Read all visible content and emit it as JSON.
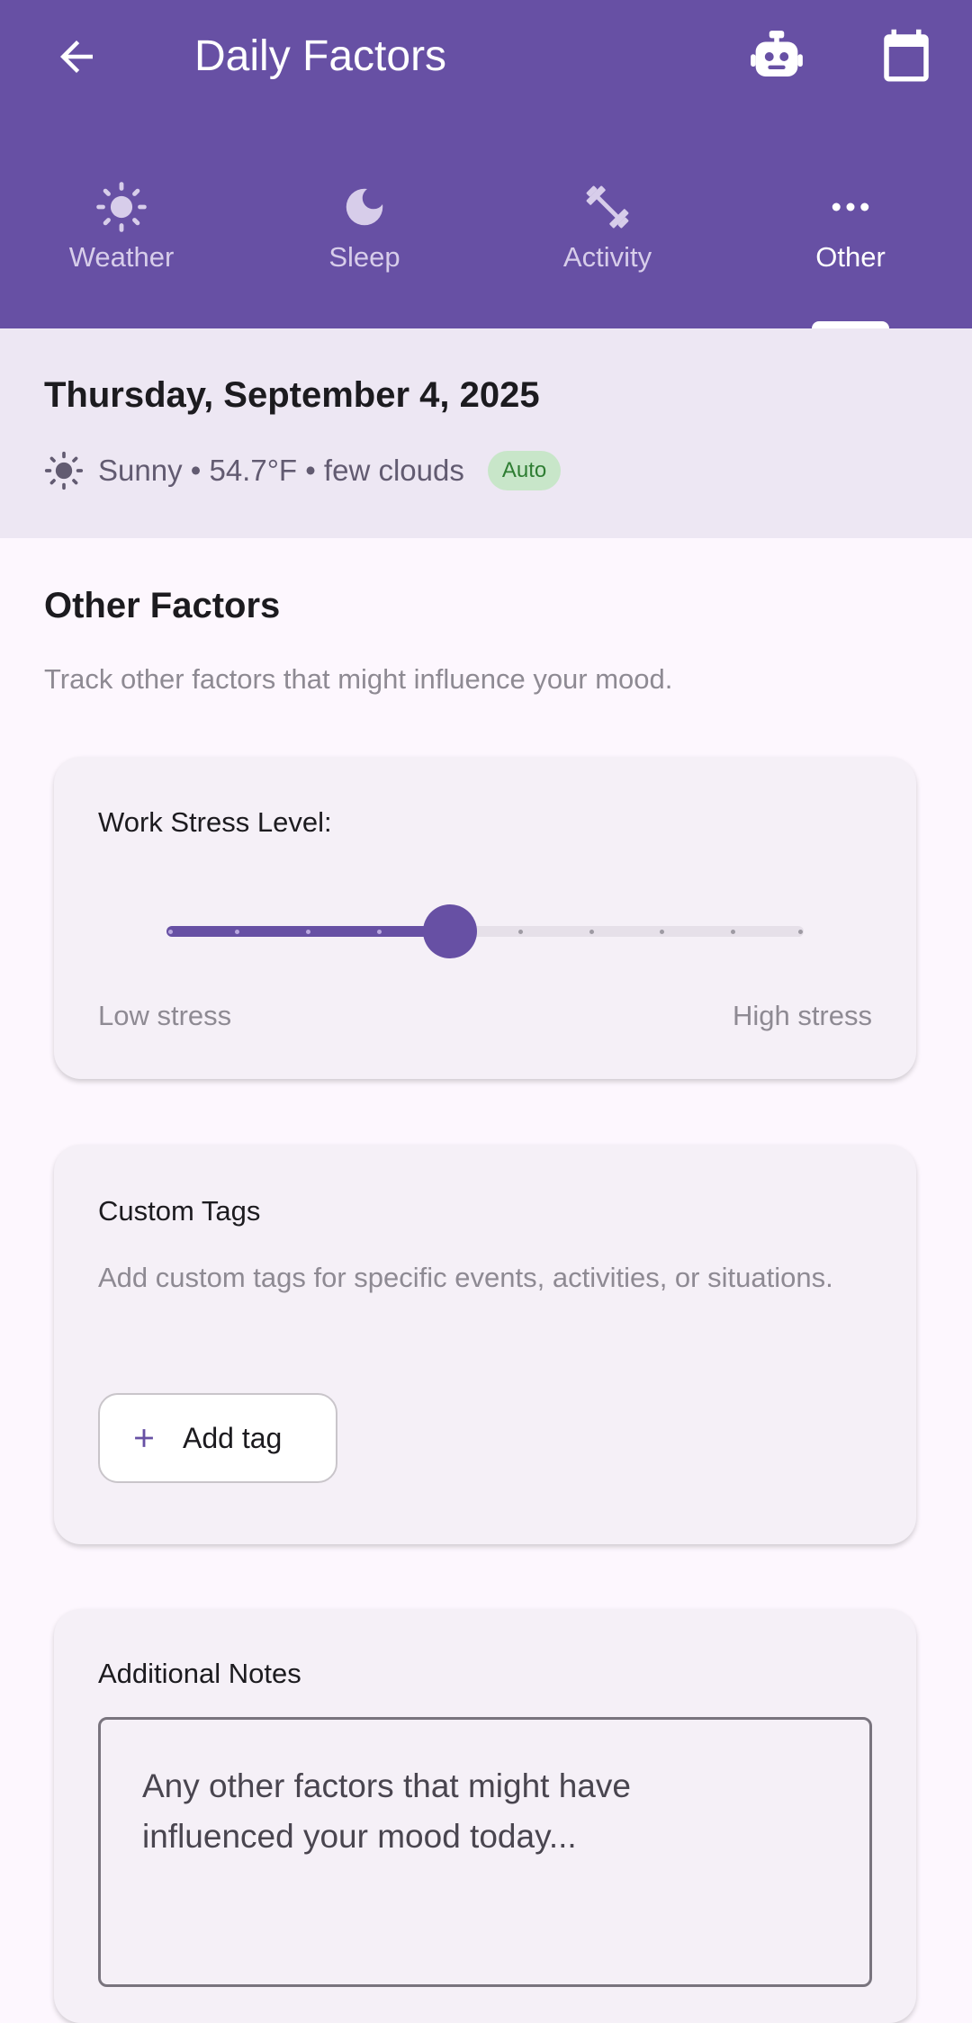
{
  "header": {
    "title": "Daily Factors",
    "back_icon": "arrow-left-icon",
    "actions": [
      "robot-icon",
      "calendar-icon"
    ]
  },
  "tabs": [
    {
      "label": "Weather",
      "icon": "sun-icon",
      "active": false
    },
    {
      "label": "Sleep",
      "icon": "moon-icon",
      "active": false
    },
    {
      "label": "Activity",
      "icon": "dumbbell-icon",
      "active": false
    },
    {
      "label": "Other",
      "icon": "more-horizontal-icon",
      "active": true
    }
  ],
  "datebar": {
    "date": "Thursday, September 4, 2025",
    "weather": "Sunny • 54.7°F • few clouds",
    "badge": "Auto"
  },
  "section": {
    "title": "Other Factors",
    "subtitle": "Track other factors that might influence your mood."
  },
  "stress": {
    "title": "Work Stress Level:",
    "value": 5,
    "min": 1,
    "max": 10,
    "low_label": "Low stress",
    "high_label": "High stress"
  },
  "tags": {
    "title": "Custom Tags",
    "description": "Add custom tags for specific events, activities, or situations.",
    "button_label": "Add tag"
  },
  "notes": {
    "title": "Additional Notes",
    "placeholder": "Any other factors that might have influenced your mood today..."
  },
  "colors": {
    "primary": "#6750a4",
    "badge_bg": "#c8e6c9",
    "badge_text": "#2e7d32"
  }
}
